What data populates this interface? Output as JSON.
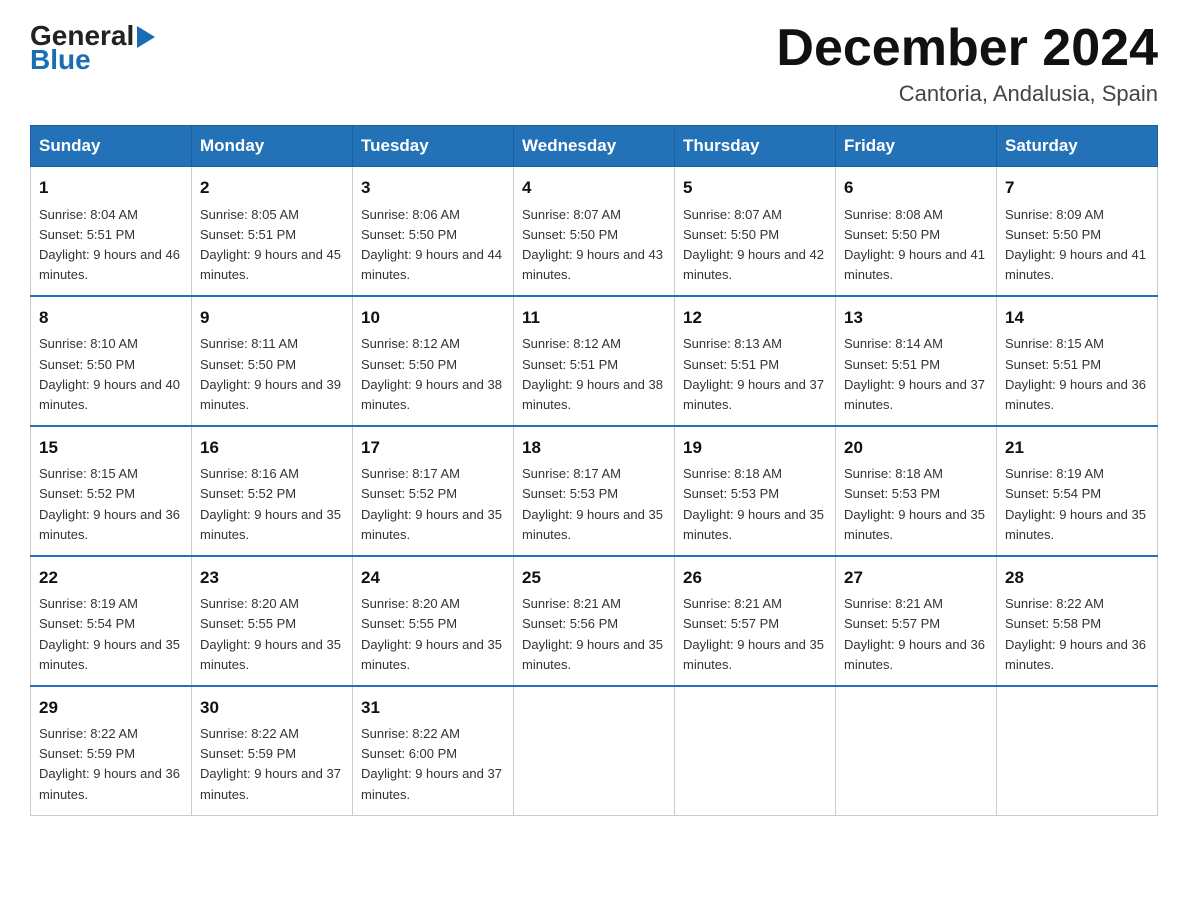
{
  "header": {
    "logo_general": "General",
    "logo_blue": "Blue",
    "month_title": "December 2024",
    "location": "Cantoria, Andalusia, Spain"
  },
  "weekdays": [
    "Sunday",
    "Monday",
    "Tuesday",
    "Wednesday",
    "Thursday",
    "Friday",
    "Saturday"
  ],
  "weeks": [
    [
      {
        "day": "1",
        "sunrise": "8:04 AM",
        "sunset": "5:51 PM",
        "daylight": "9 hours and 46 minutes."
      },
      {
        "day": "2",
        "sunrise": "8:05 AM",
        "sunset": "5:51 PM",
        "daylight": "9 hours and 45 minutes."
      },
      {
        "day": "3",
        "sunrise": "8:06 AM",
        "sunset": "5:50 PM",
        "daylight": "9 hours and 44 minutes."
      },
      {
        "day": "4",
        "sunrise": "8:07 AM",
        "sunset": "5:50 PM",
        "daylight": "9 hours and 43 minutes."
      },
      {
        "day": "5",
        "sunrise": "8:07 AM",
        "sunset": "5:50 PM",
        "daylight": "9 hours and 42 minutes."
      },
      {
        "day": "6",
        "sunrise": "8:08 AM",
        "sunset": "5:50 PM",
        "daylight": "9 hours and 41 minutes."
      },
      {
        "day": "7",
        "sunrise": "8:09 AM",
        "sunset": "5:50 PM",
        "daylight": "9 hours and 41 minutes."
      }
    ],
    [
      {
        "day": "8",
        "sunrise": "8:10 AM",
        "sunset": "5:50 PM",
        "daylight": "9 hours and 40 minutes."
      },
      {
        "day": "9",
        "sunrise": "8:11 AM",
        "sunset": "5:50 PM",
        "daylight": "9 hours and 39 minutes."
      },
      {
        "day": "10",
        "sunrise": "8:12 AM",
        "sunset": "5:50 PM",
        "daylight": "9 hours and 38 minutes."
      },
      {
        "day": "11",
        "sunrise": "8:12 AM",
        "sunset": "5:51 PM",
        "daylight": "9 hours and 38 minutes."
      },
      {
        "day": "12",
        "sunrise": "8:13 AM",
        "sunset": "5:51 PM",
        "daylight": "9 hours and 37 minutes."
      },
      {
        "day": "13",
        "sunrise": "8:14 AM",
        "sunset": "5:51 PM",
        "daylight": "9 hours and 37 minutes."
      },
      {
        "day": "14",
        "sunrise": "8:15 AM",
        "sunset": "5:51 PM",
        "daylight": "9 hours and 36 minutes."
      }
    ],
    [
      {
        "day": "15",
        "sunrise": "8:15 AM",
        "sunset": "5:52 PM",
        "daylight": "9 hours and 36 minutes."
      },
      {
        "day": "16",
        "sunrise": "8:16 AM",
        "sunset": "5:52 PM",
        "daylight": "9 hours and 35 minutes."
      },
      {
        "day": "17",
        "sunrise": "8:17 AM",
        "sunset": "5:52 PM",
        "daylight": "9 hours and 35 minutes."
      },
      {
        "day": "18",
        "sunrise": "8:17 AM",
        "sunset": "5:53 PM",
        "daylight": "9 hours and 35 minutes."
      },
      {
        "day": "19",
        "sunrise": "8:18 AM",
        "sunset": "5:53 PM",
        "daylight": "9 hours and 35 minutes."
      },
      {
        "day": "20",
        "sunrise": "8:18 AM",
        "sunset": "5:53 PM",
        "daylight": "9 hours and 35 minutes."
      },
      {
        "day": "21",
        "sunrise": "8:19 AM",
        "sunset": "5:54 PM",
        "daylight": "9 hours and 35 minutes."
      }
    ],
    [
      {
        "day": "22",
        "sunrise": "8:19 AM",
        "sunset": "5:54 PM",
        "daylight": "9 hours and 35 minutes."
      },
      {
        "day": "23",
        "sunrise": "8:20 AM",
        "sunset": "5:55 PM",
        "daylight": "9 hours and 35 minutes."
      },
      {
        "day": "24",
        "sunrise": "8:20 AM",
        "sunset": "5:55 PM",
        "daylight": "9 hours and 35 minutes."
      },
      {
        "day": "25",
        "sunrise": "8:21 AM",
        "sunset": "5:56 PM",
        "daylight": "9 hours and 35 minutes."
      },
      {
        "day": "26",
        "sunrise": "8:21 AM",
        "sunset": "5:57 PM",
        "daylight": "9 hours and 35 minutes."
      },
      {
        "day": "27",
        "sunrise": "8:21 AM",
        "sunset": "5:57 PM",
        "daylight": "9 hours and 36 minutes."
      },
      {
        "day": "28",
        "sunrise": "8:22 AM",
        "sunset": "5:58 PM",
        "daylight": "9 hours and 36 minutes."
      }
    ],
    [
      {
        "day": "29",
        "sunrise": "8:22 AM",
        "sunset": "5:59 PM",
        "daylight": "9 hours and 36 minutes."
      },
      {
        "day": "30",
        "sunrise": "8:22 AM",
        "sunset": "5:59 PM",
        "daylight": "9 hours and 37 minutes."
      },
      {
        "day": "31",
        "sunrise": "8:22 AM",
        "sunset": "6:00 PM",
        "daylight": "9 hours and 37 minutes."
      },
      null,
      null,
      null,
      null
    ]
  ]
}
